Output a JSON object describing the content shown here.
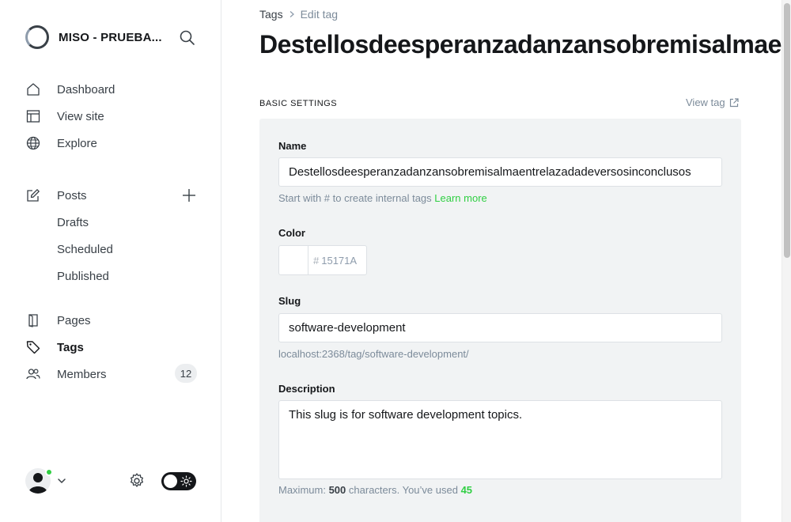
{
  "sidebar": {
    "brand_name": "MISO - PRUEBA...",
    "nav": {
      "dashboard": "Dashboard",
      "view_site": "View site",
      "explore": "Explore",
      "posts": "Posts",
      "drafts": "Drafts",
      "scheduled": "Scheduled",
      "published": "Published",
      "pages": "Pages",
      "tags": "Tags",
      "members": "Members",
      "members_count": "12"
    },
    "active_item": "tags"
  },
  "breadcrumb": {
    "parent": "Tags",
    "current": "Edit tag"
  },
  "page_title": "Destellosdeesperanzadanzansobremisalmaentrelazadadeversosinconclusos",
  "section": {
    "title": "BASIC SETTINGS",
    "view_tag": "View tag"
  },
  "form": {
    "name": {
      "label": "Name",
      "value": "Destellosdeesperanzadanzansobremisalmaentrelazadadeversosinconclusos",
      "hint": "Start with # to create internal tags",
      "hint_link": "Learn more"
    },
    "color": {
      "label": "Color",
      "hash": "#",
      "placeholder": "15171A"
    },
    "slug": {
      "label": "Slug",
      "value": "software-development",
      "url": "localhost:2368/tag/software-development/"
    },
    "description": {
      "label": "Description",
      "value": "This slug is for software development topics.",
      "hint_prefix": "Maximum:",
      "max": "500",
      "hint_middle": "characters. You’ve used",
      "used": "45"
    }
  },
  "colors": {
    "accent_green": "#30cf43",
    "dark": "#15171a",
    "panel_bg": "#f1f3f4"
  }
}
